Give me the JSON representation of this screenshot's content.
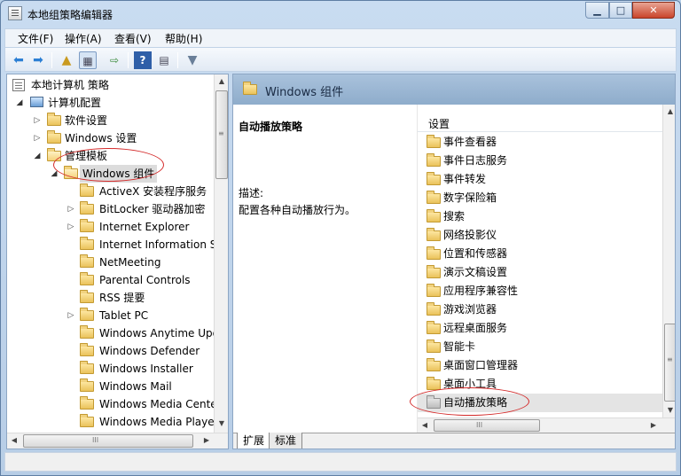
{
  "window": {
    "title": "本地组策略编辑器",
    "min_glyph": "▁",
    "max_glyph": "□",
    "close_glyph": "✕"
  },
  "menu": {
    "items": [
      "文件(F)",
      "操作(A)",
      "查看(V)",
      "帮助(H)"
    ]
  },
  "toolbar": {
    "icons": [
      "back-arrow-icon",
      "forward-arrow-icon",
      "up-folder-icon",
      "show-hide-tree-icon",
      "export-list-icon",
      "help-icon",
      "properties-icon",
      "filter-icon"
    ]
  },
  "tree": {
    "root": "本地计算机 策略",
    "computer_config": "计算机配置",
    "software_settings": "软件设置",
    "windows_settings": "Windows 设置",
    "admin_templates": "管理模板",
    "windows_components": "Windows 组件",
    "children": [
      {
        "label": "ActiveX 安装程序服务",
        "expandable": false
      },
      {
        "label": "BitLocker 驱动器加密",
        "expandable": true
      },
      {
        "label": "Internet Explorer",
        "expandable": true
      },
      {
        "label": "Internet Information S",
        "expandable": false
      },
      {
        "label": "NetMeeting",
        "expandable": false
      },
      {
        "label": "Parental Controls",
        "expandable": false
      },
      {
        "label": "RSS 提要",
        "expandable": false
      },
      {
        "label": "Tablet PC",
        "expandable": true
      },
      {
        "label": "Windows Anytime Upg",
        "expandable": false
      },
      {
        "label": "Windows Defender",
        "expandable": false
      },
      {
        "label": "Windows Installer",
        "expandable": false
      },
      {
        "label": "Windows Mail",
        "expandable": false
      },
      {
        "label": "Windows Media Cente",
        "expandable": false
      },
      {
        "label": "Windows Media Playe",
        "expandable": false
      }
    ],
    "scroll_glyph_h": "III",
    "scroll_glyph_v": "≡"
  },
  "right_pane": {
    "header_title": "Windows 组件",
    "selected_title": "自动播放策略",
    "description_label": "描述:",
    "description_text": "配置各种自动播放行为。",
    "list_header": "设置",
    "items": [
      "事件查看器",
      "事件日志服务",
      "事件转发",
      "数字保险箱",
      "搜索",
      "网络投影仪",
      "位置和传感器",
      "演示文稿设置",
      "应用程序兼容性",
      "游戏浏览器",
      "远程桌面服务",
      "智能卡",
      "桌面窗口管理器",
      "桌面小工具",
      "自动播放策略"
    ],
    "selected_index": 14
  },
  "tabs": {
    "extended": "扩展",
    "standard": "标准",
    "active": "extended"
  },
  "colors": {
    "annotation": "#d42a2a",
    "header_blue": "#8eaccb",
    "folder_yellow": "#eac25a"
  }
}
